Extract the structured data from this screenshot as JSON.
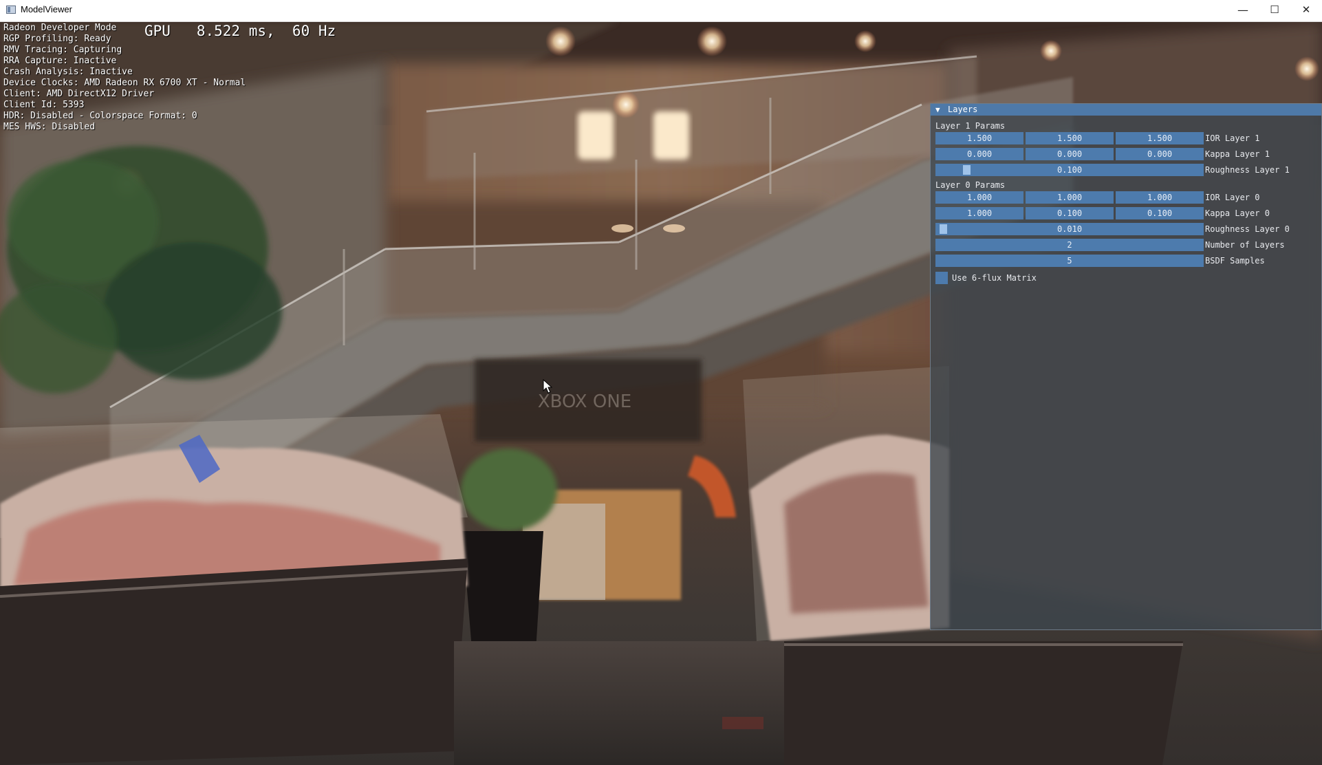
{
  "window": {
    "title": "ModelViewer",
    "controls": {
      "minimize_icon": "minimize-icon",
      "maximize_icon": "maximize-icon",
      "close_icon": "close-icon"
    }
  },
  "overlay": {
    "gpu_readout": "GPU   8.522 ms,  60 Hz",
    "diagnostics": [
      "Radeon Developer Mode",
      "RGP Profiling: Ready",
      "RMV Tracing: Capturing",
      "RRA Capture: Inactive",
      "Crash Analysis: Inactive",
      "Device Clocks: AMD Radeon RX 6700 XT - Normal",
      "Client: AMD DirectX12 Driver",
      "Client Id: 5393",
      "HDR: Disabled - Colorspace Format: 0",
      "MES HWS: Disabled"
    ]
  },
  "scene": {
    "signage_text": "XBOX ONE"
  },
  "layers_panel": {
    "title": "Layers",
    "collapse_icon": "triangle-down-icon",
    "layer1": {
      "section_label": "Layer 1 Params",
      "ior": {
        "values": [
          "1.500",
          "1.500",
          "1.500"
        ],
        "label": "IOR Layer 1"
      },
      "kappa": {
        "values": [
          "0.000",
          "0.000",
          "0.000"
        ],
        "label": "Kappa Layer 1"
      },
      "roughness": {
        "value": "0.100",
        "fraction": 0.1,
        "label": "Roughness Layer 1"
      }
    },
    "layer0": {
      "section_label": "Layer 0 Params",
      "ior": {
        "values": [
          "1.000",
          "1.000",
          "1.000"
        ],
        "label": "IOR Layer 0"
      },
      "kappa": {
        "values": [
          "1.000",
          "0.100",
          "0.100"
        ],
        "label": "Kappa Layer 0"
      },
      "roughness": {
        "value": "0.010",
        "fraction": 0.01,
        "label": "Roughness Layer 0"
      }
    },
    "number_of_layers": {
      "value": "2",
      "label": "Number of Layers"
    },
    "bsdf_samples": {
      "value": "5",
      "label": "BSDF Samples"
    },
    "six_flux": {
      "label": "Use 6-flux Matrix",
      "checked": false
    }
  },
  "colors": {
    "panel_header": "#4e79a8",
    "field_bg": "#4d7bad",
    "slider_grab": "#9fc3ea"
  }
}
